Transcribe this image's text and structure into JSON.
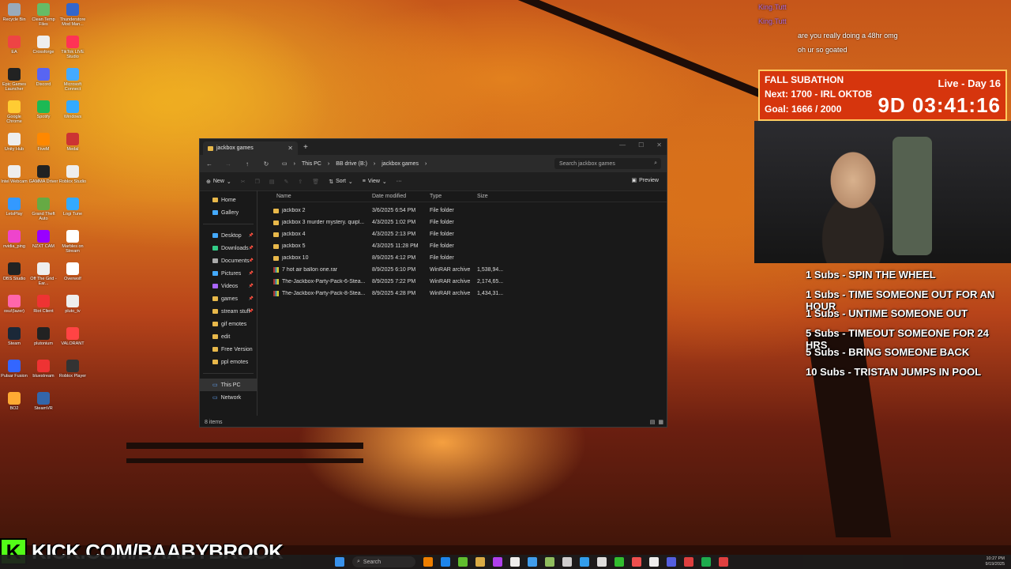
{
  "desktop": {
    "icons": [
      {
        "label": "Recycle Bin",
        "color": "#9ab"
      },
      {
        "label": "Clean Temp Files",
        "color": "#6b6"
      },
      {
        "label": "Thunderstore Mod Man...",
        "color": "#36c"
      },
      {
        "label": "EA",
        "color": "#e44"
      },
      {
        "label": "Crossforge",
        "color": "#eee"
      },
      {
        "label": "TikTok LIVE Studio",
        "color": "#f35"
      },
      {
        "label": "Epic Games Launcher",
        "color": "#222"
      },
      {
        "label": "Discord",
        "color": "#5865f2"
      },
      {
        "label": "Microsoft Connect",
        "color": "#4af"
      },
      {
        "label": "Google Chrome",
        "color": "#fc3"
      },
      {
        "label": "Spotify",
        "color": "#1db954"
      },
      {
        "label": "Windows",
        "color": "#3af"
      },
      {
        "label": "Unity Hub",
        "color": "#eee"
      },
      {
        "label": "FiveM",
        "color": "#f80"
      },
      {
        "label": "Medal",
        "color": "#c33"
      },
      {
        "label": "Intel Webcam",
        "color": "#eee"
      },
      {
        "label": "GAMMA Driver",
        "color": "#222"
      },
      {
        "label": "Roblox Studio",
        "color": "#eee"
      },
      {
        "label": "LetsPlay",
        "color": "#39f"
      },
      {
        "label": "Grand Theft Auto",
        "color": "#6a4"
      },
      {
        "label": "Logi Tune",
        "color": "#3af"
      },
      {
        "label": "nvidia_ping",
        "color": "#e4c"
      },
      {
        "label": "NZXT CAM",
        "color": "#90f"
      },
      {
        "label": "Marbles on Stream",
        "color": "#fff"
      },
      {
        "label": "OBS Studio",
        "color": "#222"
      },
      {
        "label": "Off The Grid - Ear...",
        "color": "#eee"
      },
      {
        "label": "Overwolf",
        "color": "#fff"
      },
      {
        "label": "osu!(lazer)",
        "color": "#f6a"
      },
      {
        "label": "Riot Client",
        "color": "#e33"
      },
      {
        "label": "pluto_tv",
        "color": "#eee"
      },
      {
        "label": "Steam",
        "color": "#1b2838"
      },
      {
        "label": "plutonium",
        "color": "#222"
      },
      {
        "label": "VALORANT",
        "color": "#f44"
      },
      {
        "label": "Pulsar Fusion",
        "color": "#36f"
      },
      {
        "label": "bluestream",
        "color": "#e33"
      },
      {
        "label": "Roblox Player",
        "color": "#333"
      },
      {
        "label": "BO2",
        "color": "#fa3"
      },
      {
        "label": "SteamVR",
        "color": "#36a"
      }
    ]
  },
  "explorer": {
    "tab_title": "jackbox games",
    "breadcrumbs": [
      "This PC",
      "BB drive (B:)",
      "jackbox games"
    ],
    "search_placeholder": "Search jackbox games",
    "toolbar": {
      "new": "New",
      "sort": "Sort",
      "view": "View",
      "more": "···",
      "preview": "Preview"
    },
    "sidebar": [
      {
        "label": "Home",
        "type": "home",
        "pinned": false
      },
      {
        "label": "Gallery",
        "type": "gallery",
        "pinned": false
      },
      {
        "label": "Desktop",
        "type": "desktop",
        "pinned": true
      },
      {
        "label": "Downloads",
        "type": "downloads",
        "pinned": true
      },
      {
        "label": "Documents",
        "type": "documents",
        "pinned": true
      },
      {
        "label": "Pictures",
        "type": "pictures",
        "pinned": true
      },
      {
        "label": "Videos",
        "type": "videos",
        "pinned": true
      },
      {
        "label": "games",
        "type": "folder",
        "pinned": true
      },
      {
        "label": "stream stuff",
        "type": "folder",
        "pinned": true
      },
      {
        "label": "gif emotes",
        "type": "folder",
        "pinned": false
      },
      {
        "label": "edit",
        "type": "folder",
        "pinned": false
      },
      {
        "label": "Free Version",
        "type": "folder",
        "pinned": false
      },
      {
        "label": "ppl emotes",
        "type": "folder",
        "pinned": false
      }
    ],
    "sidebar_bottom": [
      "This PC",
      "Network"
    ],
    "columns": [
      "Name",
      "Date modified",
      "Type",
      "Size"
    ],
    "files": [
      {
        "name": "jackbox 2",
        "date": "3/6/2025 6:54 PM",
        "type": "File folder",
        "size": "",
        "kind": "folder"
      },
      {
        "name": "jackbox 3 murder mystery. quipl...",
        "date": "4/3/2025 1:02 PM",
        "type": "File folder",
        "size": "",
        "kind": "folder"
      },
      {
        "name": "jackbox 4",
        "date": "4/3/2025 2:13 PM",
        "type": "File folder",
        "size": "",
        "kind": "folder"
      },
      {
        "name": "jackbox 5",
        "date": "4/3/2025 11:28 PM",
        "type": "File folder",
        "size": "",
        "kind": "folder"
      },
      {
        "name": "jackbox 10",
        "date": "8/9/2025 4:12 PM",
        "type": "File folder",
        "size": "",
        "kind": "folder"
      },
      {
        "name": "7 hot air ballon one.rar",
        "date": "8/9/2025 6:10 PM",
        "type": "WinRAR archive",
        "size": "1,538,94...",
        "kind": "rar"
      },
      {
        "name": "The-Jackbox-Party-Pack-6-Stea...",
        "date": "8/9/2025 7:22 PM",
        "type": "WinRAR archive",
        "size": "2,174,65...",
        "kind": "rar"
      },
      {
        "name": "The-Jackbox-Party-Pack-8-Stea...",
        "date": "8/9/2025 4:28 PM",
        "type": "WinRAR archive",
        "size": "1,434,31...",
        "kind": "rar"
      }
    ],
    "status": "8 items"
  },
  "chat": [
    {
      "user": "King.Tutt",
      "text": ""
    },
    {
      "user": "King.Tutt",
      "text": ""
    },
    {
      "user": "",
      "text": "are you really doing a 48hr omg"
    },
    {
      "user": "",
      "text": "oh ur so goated"
    }
  ],
  "subathon": {
    "title": "FALL SUBATHON",
    "next": "Next: 1700 - IRL OKTOB",
    "goal": "Goal: 1666 / 2000",
    "live": "Live - Day 16",
    "timer": "9D 03:41:16"
  },
  "sub_rewards": [
    "1 Subs - SPIN THE WHEEL",
    "1 Subs - TIME SOMEONE OUT FOR AN HOUR",
    "1 Subs - UNTIME SOMEONE OUT",
    "5 Subs - TIMEOUT SOMEONE FOR 24 HRS",
    "5 Subs - BRING SOMEONE BACK",
    "10 Subs - TRISTAN JUMPS IN POOL"
  ],
  "kick_banner": {
    "logo": "K",
    "text": "KICK.COM/BAABYBROOK"
  },
  "taskbar": {
    "search": "Search",
    "time": "10:27 PM",
    "date": "9/19/2025",
    "app_colors": [
      "#f80",
      "#1e90ff",
      "#6c3",
      "#e8b84a",
      "#b4f",
      "#fff",
      "#4af",
      "#9c6",
      "#ddd",
      "#3af",
      "#eee",
      "#3c3",
      "#f55",
      "#fff",
      "#5865f2",
      "#e44",
      "#1db954",
      "#e44"
    ]
  }
}
